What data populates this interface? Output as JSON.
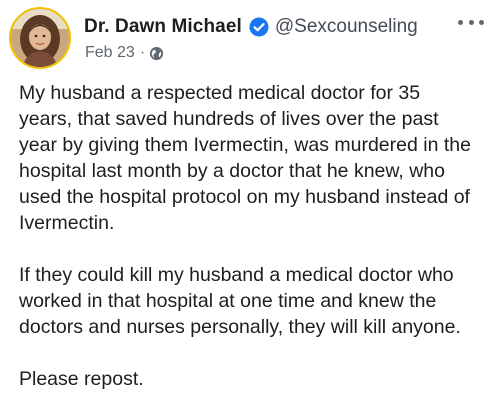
{
  "post": {
    "author_name": "Dr. Dawn Michael",
    "handle": "@Sexcounseling",
    "date": "Feb 23",
    "separator": "·",
    "verified_icon": "verified-badge-icon",
    "privacy_icon": "globe-icon",
    "more_icon": "more-options-icon",
    "colors": {
      "verified": "#1877f2",
      "avatar_ring": "#f2c200",
      "secondary_text": "#606770"
    },
    "paragraphs": [
      "My husband a respected medical doctor for 35\nyears, that saved hundreds of lives over the past\nyear by giving them Ivermectin, was murdered in the\nhospital last month by a doctor that he knew, who\nused the hospital protocol on my husband instead of\nIvermectin.",
      "If they could kill my husband a medical doctor who\nworked in that hospital at one time and knew the\ndoctors and nurses personally, they will kill anyone.",
      "Please repost."
    ]
  }
}
